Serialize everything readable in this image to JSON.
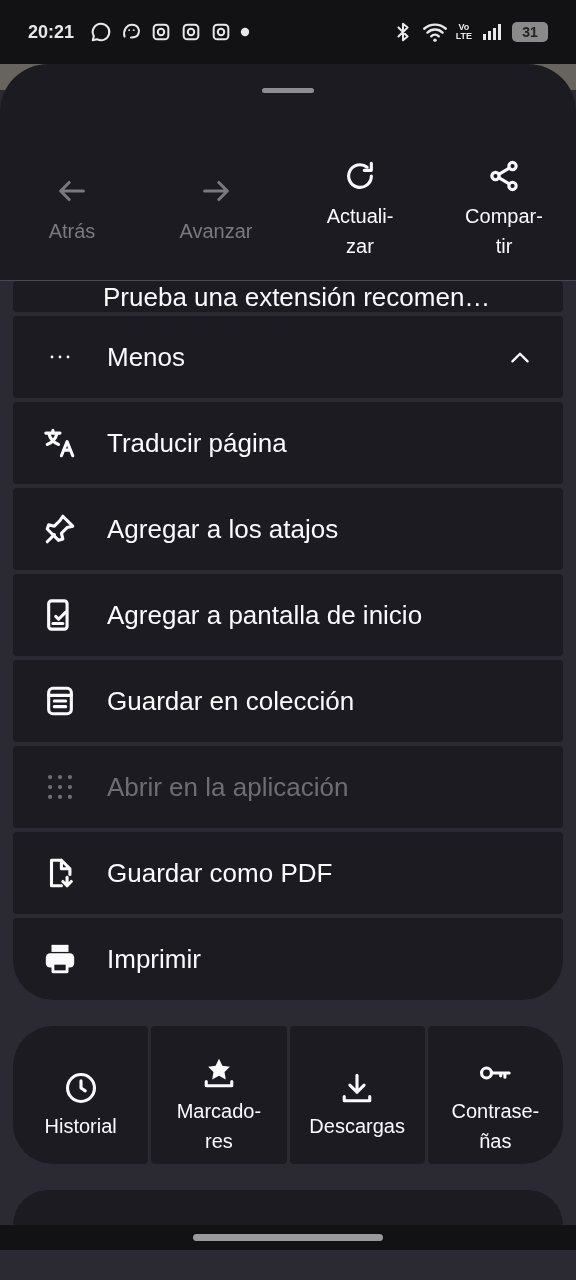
{
  "status_bar": {
    "time": "20:21",
    "network": "Vo\nLTE",
    "battery": "31"
  },
  "nav_actions": [
    {
      "label": "Atrás",
      "disabled": true
    },
    {
      "label": "Avanzar",
      "disabled": true
    },
    {
      "label": "Actuali-\nzar",
      "disabled": false
    },
    {
      "label": "Compar-\ntir",
      "disabled": false
    }
  ],
  "menu_items": [
    {
      "kind": "partial",
      "label": "Prueba una extensión recomen…",
      "disabled": false
    },
    {
      "kind": "toggle",
      "label": "Menos",
      "disabled": false,
      "expanded": true
    },
    {
      "kind": "item",
      "label": "Traducir página",
      "disabled": false
    },
    {
      "kind": "item",
      "label": "Agregar a los atajos",
      "disabled": false
    },
    {
      "kind": "item",
      "label": "Agregar a pantalla de inicio",
      "disabled": false
    },
    {
      "kind": "item",
      "label": "Guardar en colección",
      "disabled": false
    },
    {
      "kind": "item",
      "label": "Abrir en la aplicación",
      "disabled": true
    },
    {
      "kind": "item",
      "label": "Guardar como PDF",
      "disabled": false
    },
    {
      "kind": "item",
      "label": "Imprimir",
      "disabled": false
    }
  ],
  "shortcuts": [
    {
      "label": "Historial"
    },
    {
      "label": "Marcado-\nres"
    },
    {
      "label": "Descargas"
    },
    {
      "label": "Contrase-\nñas"
    }
  ]
}
